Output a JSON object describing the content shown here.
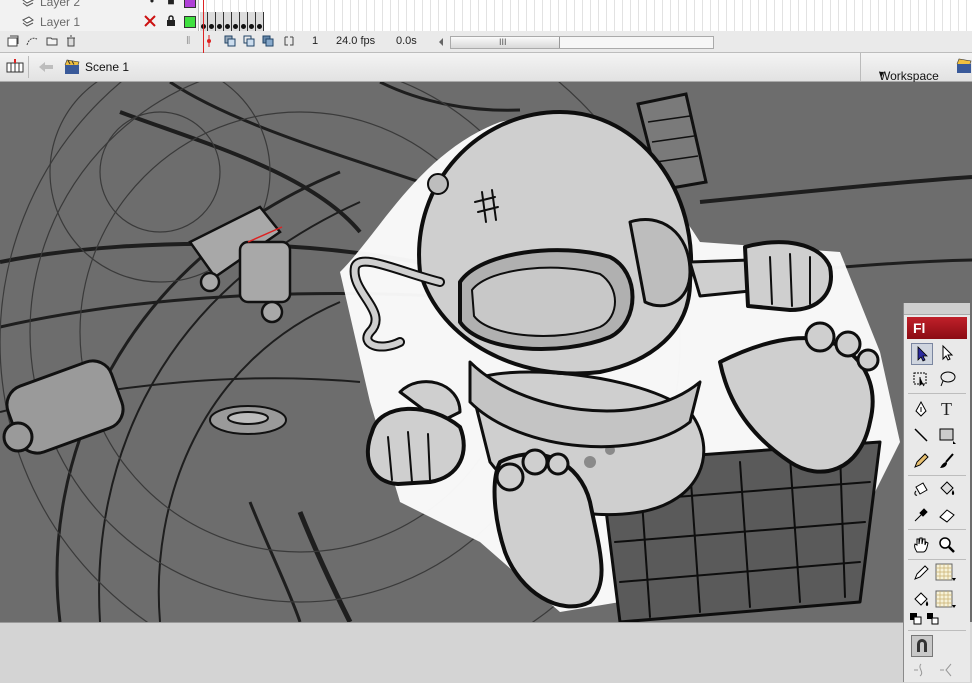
{
  "timeline": {
    "layers": [
      {
        "name": "Layer 2"
      },
      {
        "name": "Layer 1"
      }
    ],
    "frame_number": "1",
    "fps": "24.0 fps",
    "elapsed": "0.0s",
    "scroll_grip": "III"
  },
  "editbar": {
    "scene_label": "Scene 1",
    "workspace_label": "Workspace",
    "workspace_arrow": "▾"
  },
  "tools_panel": {
    "logo": "Fl",
    "text_tool_glyph": "T"
  },
  "colors": {
    "stage_bg": "#6d6d6d",
    "layer2_color": "#b040d8",
    "layer1_color": "#40e040",
    "playhead": "#dd2222",
    "delete_x": "#cc1111"
  }
}
